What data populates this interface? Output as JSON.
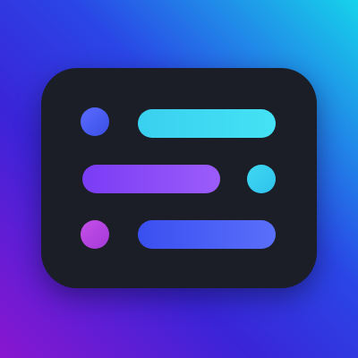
{
  "icon": {
    "name": "list-app-icon",
    "colors": {
      "background_top_right": "#16d3ea",
      "background_mid": "#3a24d8",
      "background_bottom_left": "#8a16d0",
      "card": "#1b1e27",
      "accent_blue": "#4a5cf2",
      "accent_cyan": "#3ad0f0",
      "accent_purple": "#8a4af7",
      "accent_magenta": "#c54fe8"
    },
    "rows": [
      {
        "dot_side": "left",
        "dot_color": "#4a5cf2",
        "bar_color": "#3ad0f0"
      },
      {
        "dot_side": "right",
        "dot_color": "#3ad0f0",
        "bar_color": "#8a4af7"
      },
      {
        "dot_side": "left",
        "dot_color": "#c54fe8",
        "bar_color": "#4a5cf2"
      }
    ]
  }
}
